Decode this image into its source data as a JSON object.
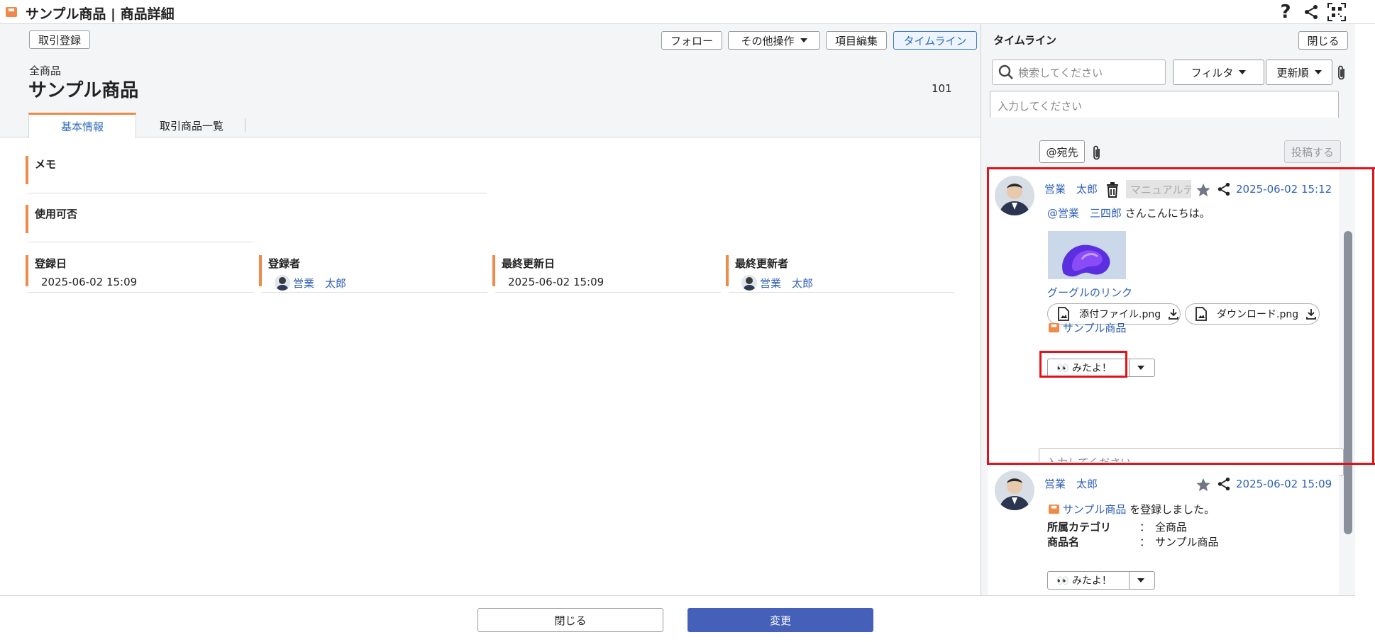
{
  "header": {
    "title": "サンプル商品 | 商品詳細",
    "help_glyph": "?",
    "icons": [
      "help-icon",
      "share-icon",
      "qr-code-icon"
    ]
  },
  "toolbar": {
    "register_deal": "取引登録",
    "follow": "フォロー",
    "other_actions": "その他操作",
    "edit_fields": "項目編集",
    "timeline": "タイムライン"
  },
  "record": {
    "category": "全商品",
    "name": "サンプル商品",
    "id_number": "101"
  },
  "tabs": [
    {
      "label": "基本情報",
      "active": true
    },
    {
      "label": "取引商品一覧",
      "active": false
    }
  ],
  "fields": {
    "memo_label": "メモ",
    "usable_label": "使用可否",
    "created_date_label": "登録日",
    "created_date": "2025-06-02  15:09",
    "creator_label": "登録者",
    "creator": "営業　太郎",
    "updated_date_label": "最終更新日",
    "updated_date": "2025-06-02  15:09",
    "updater_label": "最終更新者",
    "updater": "営業　太郎"
  },
  "footer": {
    "close": "閉じる",
    "change": "変更"
  },
  "timeline": {
    "title": "タイムライン",
    "close": "閉じる",
    "search_placeholder": "検索してください",
    "filter": "フィルタ",
    "sort": "更新順",
    "compose_placeholder": "入力してください",
    "mention_button": "@宛先",
    "post_button": "投稿する",
    "posts": [
      {
        "author": "営業　太郎",
        "manual_button": "マニュアルテ",
        "timestamp": "2025-06-02 15:12",
        "mention": "@営業　三四郎",
        "text": "さんこんにちは。",
        "link_text": "グーグルのリンク",
        "attachments": [
          "添付ファイル.png",
          "ダウンロード.png"
        ],
        "record_link": "サンプル商品",
        "reaction": "👀 みたよ！",
        "reply_placeholder": "入力してください"
      },
      {
        "author": "営業　太郎",
        "timestamp": "2025-06-02 15:09",
        "record_link": "サンプル商品",
        "registered_text": "を登録しました。",
        "rows": [
          {
            "label": "所属カテゴリ",
            "sep": "：",
            "value": "全商品"
          },
          {
            "label": "商品名",
            "sep": "：",
            "value": "サンプル商品"
          }
        ],
        "reaction": "👀 みたよ！"
      }
    ]
  },
  "colors": {
    "accent_orange": "#f08a4b",
    "link_blue": "#2f5fb8",
    "primary_button": "#4560b8",
    "highlight_red": "#e0131a"
  }
}
